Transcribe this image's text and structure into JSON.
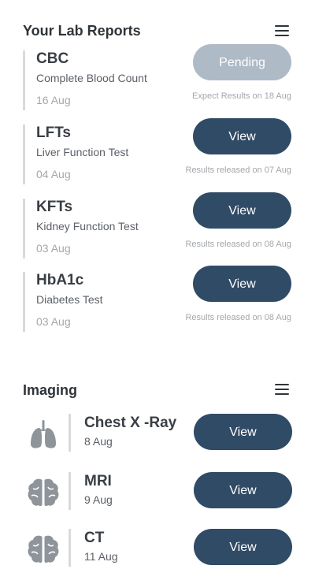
{
  "lab_reports": {
    "title": "Your Lab Reports",
    "items": [
      {
        "code": "CBC",
        "name": "Complete Blood Count",
        "date": "16 Aug",
        "button": "Pending",
        "note": "Expect Results on 18 Aug"
      },
      {
        "code": "LFTs",
        "name": "Liver Function Test",
        "date": "04 Aug",
        "button": "View",
        "note": "Results released on 07 Aug"
      },
      {
        "code": "KFTs",
        "name": "Kidney Function Test",
        "date": "03 Aug",
        "button": "View",
        "note": "Results released on 08 Aug"
      },
      {
        "code": "HbA1c",
        "name": "Diabetes Test",
        "date": "03 Aug",
        "button": "View",
        "note": "Results released on 08 Aug"
      }
    ]
  },
  "imaging": {
    "title": "Imaging",
    "items": [
      {
        "name": "Chest X -Ray",
        "date": "8 Aug",
        "button": "View",
        "icon": "lungs-icon"
      },
      {
        "name": "MRI",
        "date": "9 Aug",
        "button": "View",
        "icon": "brain-icon"
      },
      {
        "name": "CT",
        "date": "11 Aug",
        "button": "View",
        "icon": "brain-icon"
      }
    ]
  },
  "colors": {
    "view_button": "#304b66",
    "pending_button": "#aebac6",
    "icon_gray": "#8e949a"
  }
}
